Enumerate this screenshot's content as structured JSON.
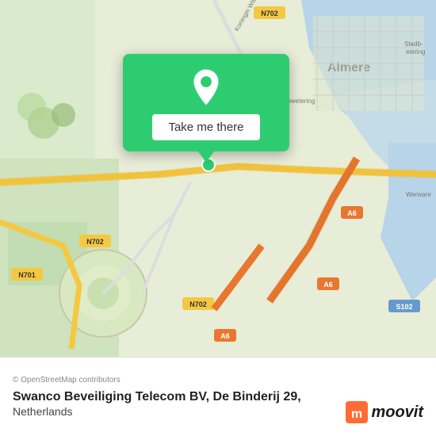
{
  "map": {
    "center_lat": 52.37,
    "center_lon": 5.21,
    "location_name": "Almere",
    "roads": {
      "n702": "N702",
      "n701": "N701",
      "a6": "A6",
      "s102": "S102"
    }
  },
  "popup": {
    "button_label": "Take me there",
    "pin_color": "#ffffff"
  },
  "footer": {
    "attribution": "© OpenStreetMap contributors",
    "business_name": "Swanco Beveiliging Telecom BV, De Binderij 29,",
    "business_country": "Netherlands",
    "moovit_brand": "moovit"
  }
}
